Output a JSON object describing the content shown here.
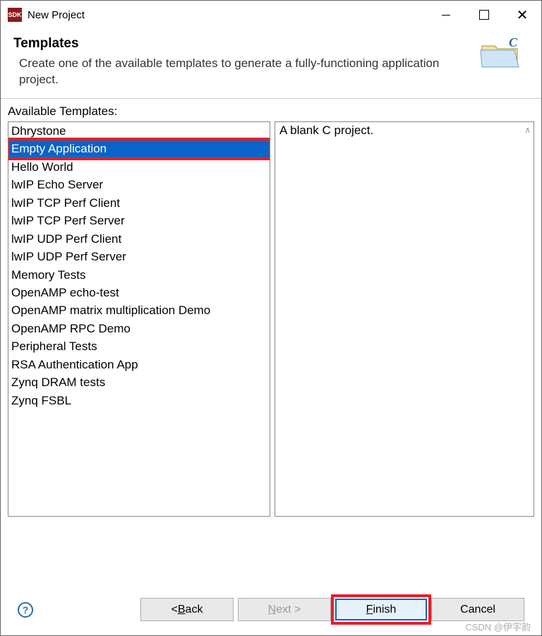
{
  "window": {
    "app_icon_text": "SDK",
    "title": "New Project"
  },
  "header": {
    "title": "Templates",
    "description": "Create one of the available templates to generate a fully-functioning application project."
  },
  "available_label": "Available Templates:",
  "templates": [
    {
      "name": "Dhrystone",
      "selected": false
    },
    {
      "name": "Empty Application",
      "selected": true
    },
    {
      "name": "Hello World",
      "selected": false
    },
    {
      "name": "lwIP Echo Server",
      "selected": false
    },
    {
      "name": "lwIP TCP Perf Client",
      "selected": false
    },
    {
      "name": "lwIP TCP Perf Server",
      "selected": false
    },
    {
      "name": "lwIP UDP Perf Client",
      "selected": false
    },
    {
      "name": "lwIP UDP Perf Server",
      "selected": false
    },
    {
      "name": "Memory Tests",
      "selected": false
    },
    {
      "name": "OpenAMP echo-test",
      "selected": false
    },
    {
      "name": "OpenAMP matrix multiplication Demo",
      "selected": false
    },
    {
      "name": "OpenAMP RPC Demo",
      "selected": false
    },
    {
      "name": "Peripheral Tests",
      "selected": false
    },
    {
      "name": "RSA Authentication App",
      "selected": false
    },
    {
      "name": "Zynq DRAM tests",
      "selected": false
    },
    {
      "name": "Zynq FSBL",
      "selected": false
    }
  ],
  "description_text": "A blank C project.",
  "buttons": {
    "back": "< Back",
    "next": "Next >",
    "finish": "Finish",
    "cancel": "Cancel"
  },
  "help_tooltip": "?",
  "watermark": "CSDN @伊宇韵"
}
